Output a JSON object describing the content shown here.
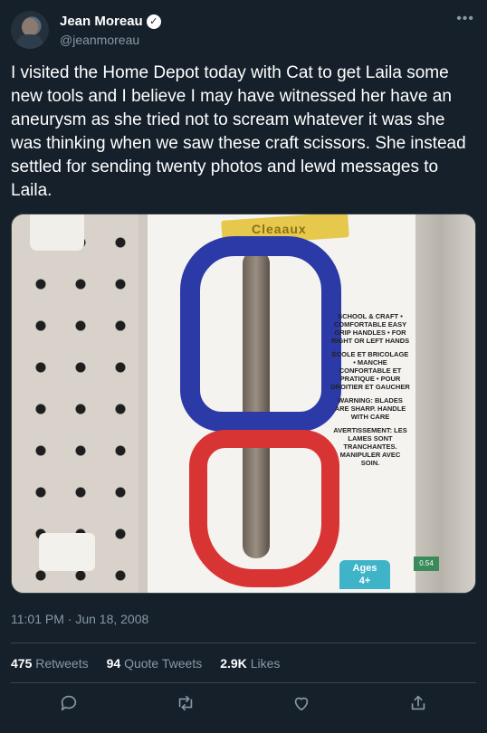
{
  "author": {
    "display_name": "Jean Moreau",
    "handle": "@jeanmoreau",
    "verified_icon": "verified-badge-icon"
  },
  "menu_icon": "more-icon",
  "tweet": {
    "text": "I visited the Home Depot today with Cat to get Laila some new tools and I believe I may have witnessed her have an aneurysm as she tried not to scream whatever it was she was thinking when we saw these craft scissors. She instead settled for sending twenty photos and lewd messages to Laila.",
    "timestamp": "11:01 PM · Jun 18, 2008"
  },
  "photo": {
    "brand": "Cleaaux",
    "card_lines": [
      "SCHOOL & CRAFT • COMFORTABLE EASY GRIP HANDLES • FOR RIGHT OR LEFT HANDS",
      "ÉCOLE ET BRICOLAGE • MANCHE CONFORTABLE ET PRATIQUE • POUR DROITIER ET GAUCHER",
      "WARNING: BLADES ARE SHARP. HANDLE WITH CARE",
      "AVERTISSEMENT: LES LAMES SONT TRANCHANTES. MANIPULER AVEC SOIN."
    ],
    "ages_label": "Ages",
    "ages_value": "4+",
    "price_tag": "0.54"
  },
  "stats": {
    "retweets_count": "475",
    "retweets_label": "Retweets",
    "quotes_count": "94",
    "quotes_label": "Quote Tweets",
    "likes_count": "2.9K",
    "likes_label": "Likes"
  },
  "actions": [
    "reply-icon",
    "retweet-icon",
    "like-icon",
    "share-icon"
  ],
  "colors": {
    "background": "#15202b",
    "secondary_text": "#8899a6",
    "divider": "#38444d"
  }
}
